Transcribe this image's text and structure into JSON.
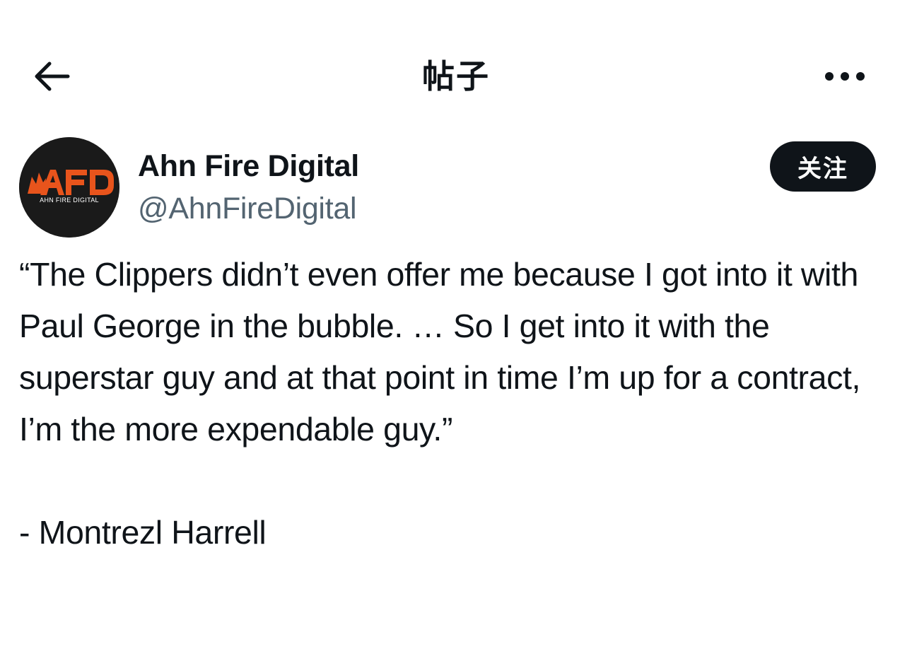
{
  "header": {
    "title": "帖子",
    "back_icon": "arrow-left-icon",
    "more_icon": "ellipsis-icon"
  },
  "author": {
    "name": "Ahn Fire Digital",
    "handle": "@AhnFireDigital",
    "avatar_logo_text": "AFD",
    "avatar_subtext": "AHN FIRE DIGITAL",
    "avatar_bg": "#1a1a1a",
    "logo_color": "#e8541c"
  },
  "follow_button": {
    "label": "关注"
  },
  "post": {
    "text": "“The Clippers didn’t even offer me because I got into it with Paul George in the bubble. … So I get into it with the superstar guy and at that point in time I’m up for a contract, I’m the more expendable guy.”\n\n- Montrezl Harrell"
  },
  "colors": {
    "text_primary": "#0f1419",
    "text_secondary": "#536471",
    "button_bg": "#0f1419",
    "background": "#ffffff"
  }
}
